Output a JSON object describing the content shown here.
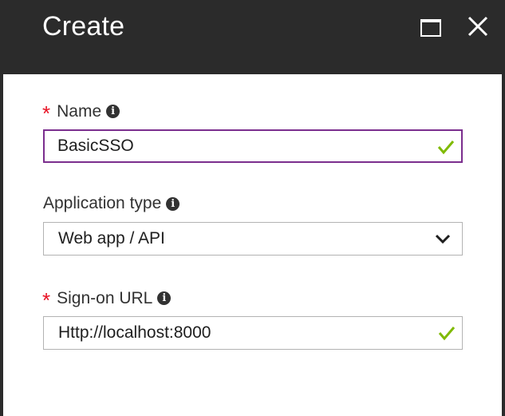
{
  "blade": {
    "title": "Create"
  },
  "form": {
    "name": {
      "required_mark": "*",
      "label": "Name",
      "value": "BasicSSO",
      "info_glyph": "i"
    },
    "app_type": {
      "label": "Application type",
      "selected": "Web app / API",
      "info_glyph": "i"
    },
    "signon_url": {
      "required_mark": "*",
      "label": "Sign-on URL",
      "value": "Http://localhost:8000",
      "info_glyph": "i"
    }
  },
  "colors": {
    "header_bg": "#2b2b2b",
    "required": "#e81123",
    "focus_border": "#7b2e8e",
    "valid_check": "#7fba00"
  },
  "icons": [
    "maximize-icon",
    "close-icon",
    "info-icon",
    "check-icon",
    "chevron-down-icon"
  ]
}
